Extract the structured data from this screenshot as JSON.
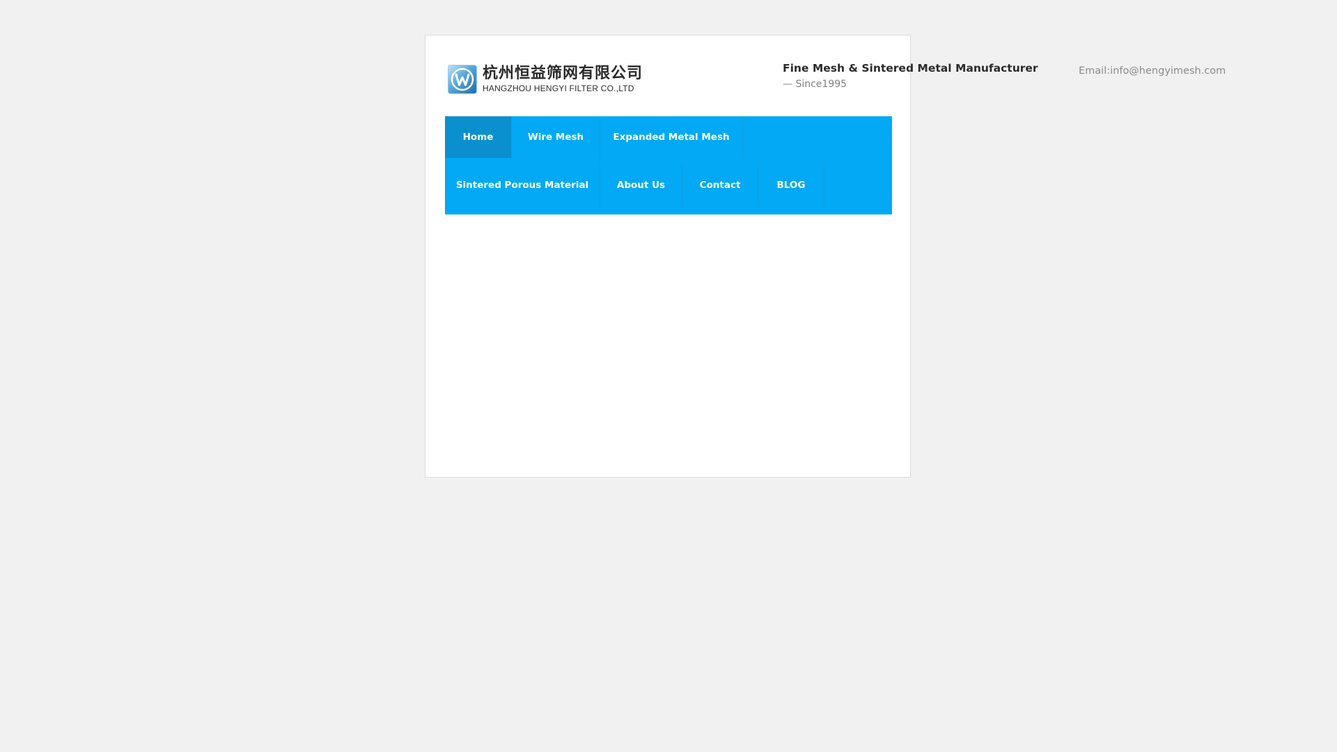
{
  "header": {
    "logo": {
      "chinese_name": "杭州恒益筛网有限公司",
      "english_name": "HANGZHOU HENGYI FILTER CO.,LTD",
      "icon": "w-emblem-logo-icon"
    },
    "tagline_title": "Fine Mesh & Sintered Metal Manufacturer",
    "tagline_sub": "— Since1995",
    "email": "Email:info@hengyimesh.com"
  },
  "nav": {
    "row1": [
      {
        "label": "Home",
        "active": true
      },
      {
        "label": "Wire Mesh",
        "active": false
      },
      {
        "label": "Expanded Metal Mesh",
        "active": false
      }
    ],
    "row2": [
      {
        "label": "Sintered Porous Material",
        "active": false
      },
      {
        "label": "About Us",
        "active": false
      },
      {
        "label": "Contact",
        "active": false
      },
      {
        "label": "BLOG",
        "active": false
      }
    ]
  },
  "colors": {
    "page_background": "#f1f1f1",
    "nav_background": "#03a9f4",
    "nav_active": "#0b90cf",
    "nav_text": "#ffffff"
  }
}
